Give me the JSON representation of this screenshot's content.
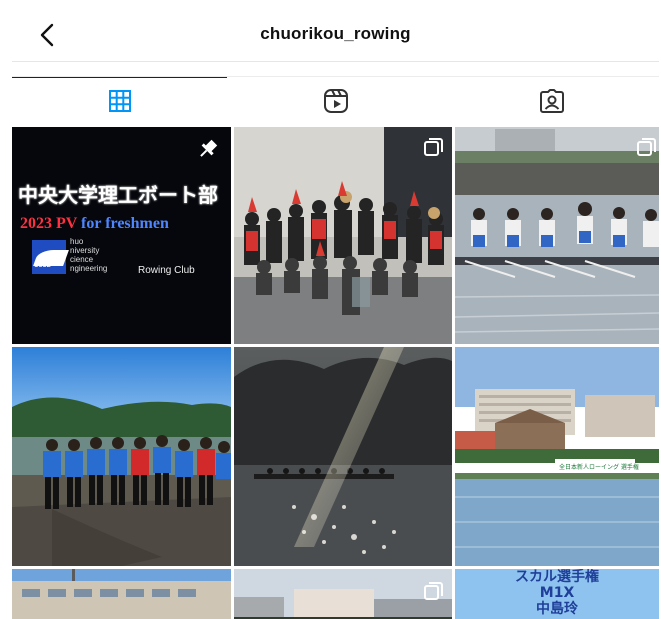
{
  "header": {
    "title": "chuorikou_rowing",
    "back_icon": "chevron-left-icon"
  },
  "tabs": [
    {
      "name": "posts",
      "icon": "grid-icon",
      "active": true,
      "color": "#0095f6"
    },
    {
      "name": "reels",
      "icon": "reels-icon",
      "active": false
    },
    {
      "name": "tagged",
      "icon": "tagged-person-icon",
      "active": false
    }
  ],
  "posts": [
    {
      "id": "post-1",
      "overlay_icon": "pin-icon",
      "thumbnail_text": {
        "title": "中央大学理工ボート部",
        "year": "2023 PV",
        "subtitle": "for freshmen",
        "logo_text": "CUSE",
        "logo_lines": [
          "huo",
          "niversity",
          "cience",
          "ngineering"
        ],
        "club": "Rowing Club"
      }
    },
    {
      "id": "post-2",
      "overlay_icon": "carousel-icon"
    },
    {
      "id": "post-3",
      "overlay_icon": "carousel-icon"
    },
    {
      "id": "post-4",
      "overlay_icon": ""
    },
    {
      "id": "post-5",
      "overlay_icon": ""
    },
    {
      "id": "post-6",
      "overlay_icon": "",
      "thumbnail_text": {
        "banner": "全日本新人ローイング 選手権"
      }
    },
    {
      "id": "post-7",
      "overlay_icon": ""
    },
    {
      "id": "post-8",
      "overlay_icon": "carousel-icon"
    },
    {
      "id": "post-9",
      "overlay_icon": "",
      "thumbnail_text": {
        "line1": "スカル選手権",
        "line2": "M1X",
        "line3": "中島玲"
      }
    }
  ],
  "colors": {
    "accent": "#0095f6",
    "text": "#111111",
    "divider": "#e6e6e6"
  }
}
